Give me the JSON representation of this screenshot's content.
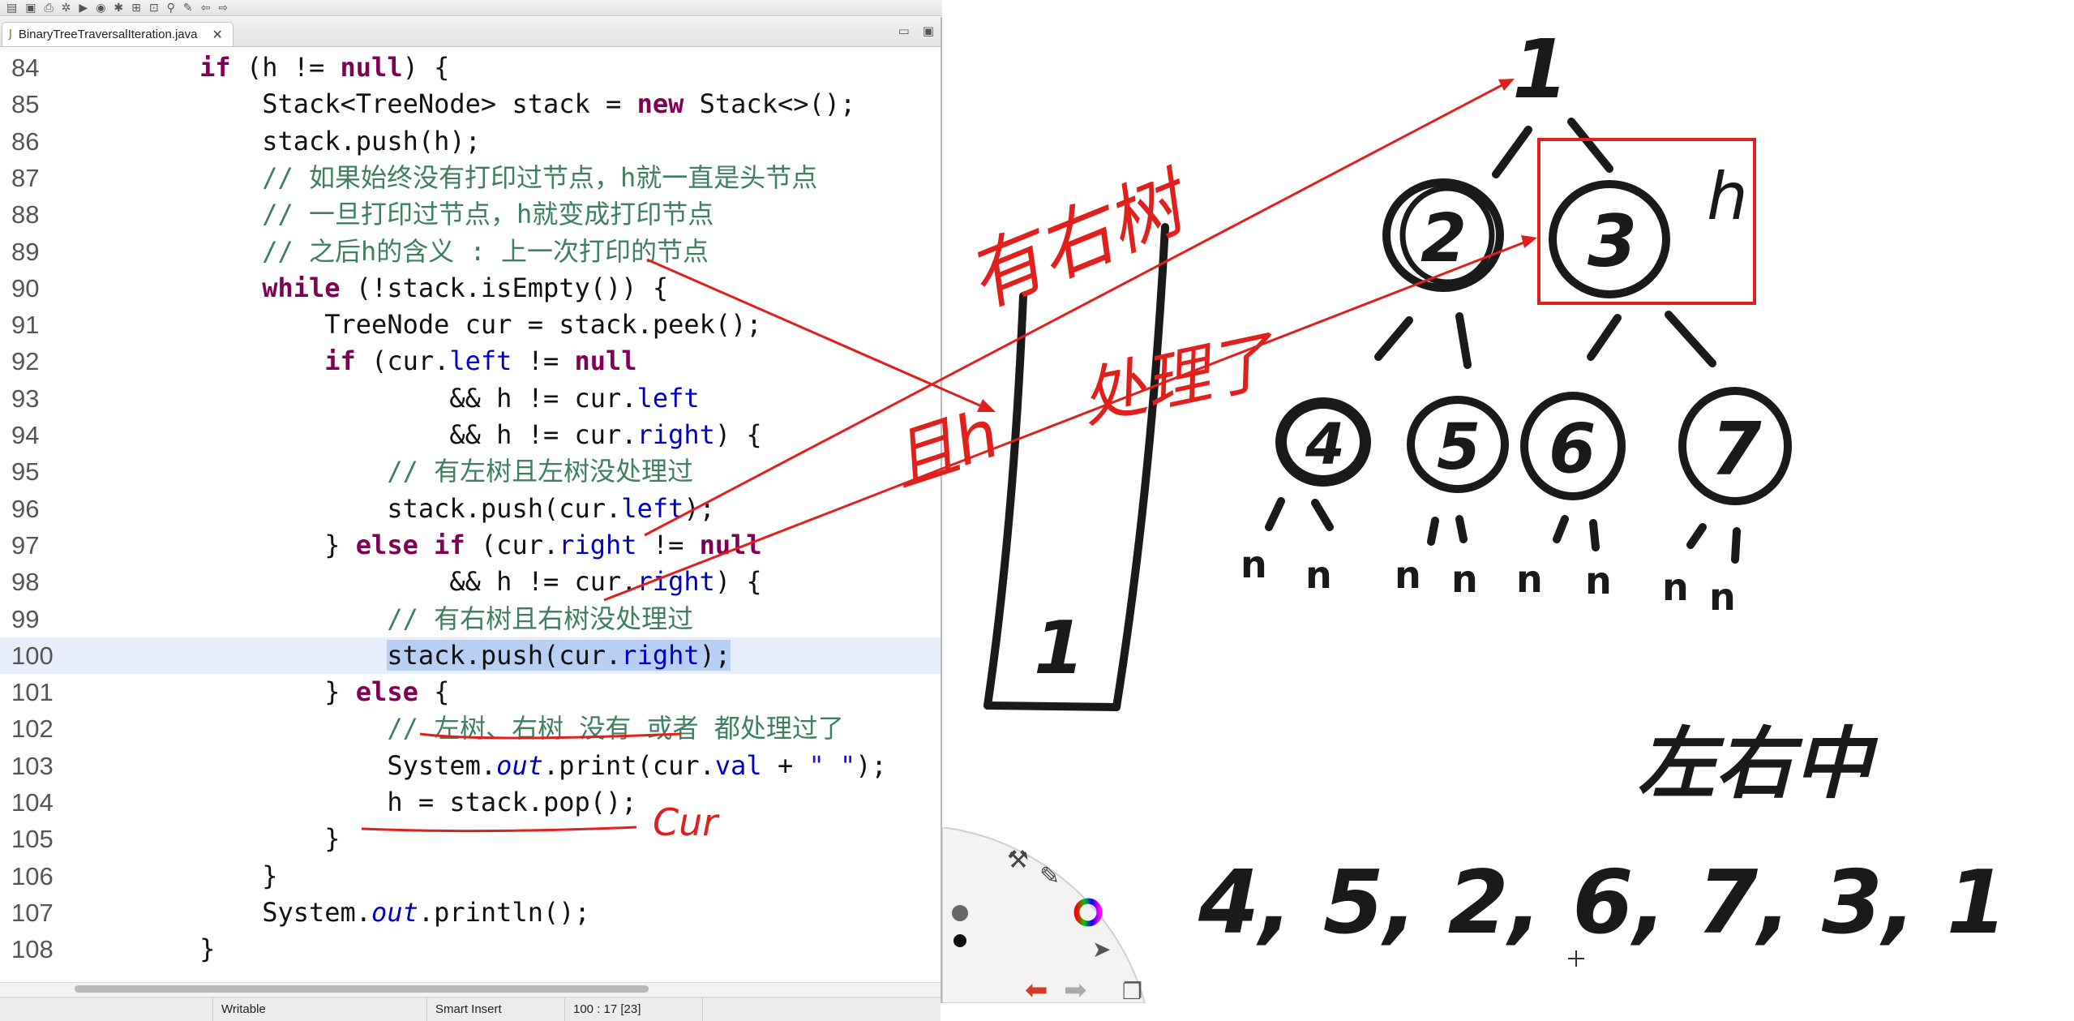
{
  "editor": {
    "tab_title": "BinaryTreeTraversalIteration.java",
    "lines": [
      {
        "n": "84",
        "html": "        <span class='kw'>if</span> (h != <span class='kw'>null</span>) {"
      },
      {
        "n": "85",
        "html": "            Stack&lt;TreeNode&gt; stack = <span class='kw'>new</span> Stack&lt;&gt;();"
      },
      {
        "n": "86",
        "html": "            stack.push(h);"
      },
      {
        "n": "87",
        "html": "            <span class='cm'>// 如果始终没有打印过节点，h就一直是头节点</span>"
      },
      {
        "n": "88",
        "html": "            <span class='cm'>// 一旦打印过节点，h就变成打印节点</span>"
      },
      {
        "n": "89",
        "html": "            <span class='cm'>// 之后h的含义 : 上一次打印的节点</span>"
      },
      {
        "n": "90",
        "html": "            <span class='kw'>while</span> (!stack.isEmpty()) {"
      },
      {
        "n": "91",
        "html": "                TreeNode cur = stack.peek();"
      },
      {
        "n": "92",
        "html": "                <span class='kw'>if</span> (cur.<span class='fd'>left</span> != <span class='kw'>null</span>"
      },
      {
        "n": "93",
        "html": "                        &amp;&amp; h != cur.<span class='fd'>left</span>"
      },
      {
        "n": "94",
        "html": "                        &amp;&amp; h != cur.<span class='fd'>right</span>) {"
      },
      {
        "n": "95",
        "html": "                    <span class='cm'>// 有左树且左树没处理过</span>"
      },
      {
        "n": "96",
        "html": "                    stack.push(cur.<span class='fd'>left</span>);"
      },
      {
        "n": "97",
        "html": "                } <span class='kw'>else if</span> (cur.<span class='fd'>right</span> != <span class='kw'>null</span>"
      },
      {
        "n": "98",
        "html": "                        &amp;&amp; h != cur.<span class='fd'>right</span>) {"
      },
      {
        "n": "99",
        "html": "                    <span class='cm'>// 有右树且右树没处理过</span>"
      },
      {
        "n": "100",
        "html": "                    <span class='sel'>stack.push(cur.<span class='fd'>right</span>);</span>",
        "current": true
      },
      {
        "n": "101",
        "html": "                } <span class='kw'>else</span> {"
      },
      {
        "n": "102",
        "html": "                    <span class='cm'>// 左树、右树 没有 或者 都处理过了</span>"
      },
      {
        "n": "103",
        "html": "                    System.<span class='st'>out</span>.print(cur.<span class='fd'>val</span> + <span class='str'>\" \"</span>);"
      },
      {
        "n": "104",
        "html": "                    h = stack.pop();"
      },
      {
        "n": "105",
        "html": "                }"
      },
      {
        "n": "106",
        "html": "            }"
      },
      {
        "n": "107",
        "html": "            System.<span class='st'>out</span>.println();"
      },
      {
        "n": "108",
        "html": "        }"
      }
    ]
  },
  "status": {
    "writable": "Writable",
    "insert_mode": "Smart Insert",
    "position": "100 : 17 [23]"
  },
  "annotations": {
    "cur_label": "Cur",
    "has_right": "有右树",
    "and_h": "且h",
    "processed": "处理了",
    "h_label": "h",
    "order_label": "左右中",
    "postorder": "4, 5, 2, 6, 7, 3, 1",
    "stack_item": "1"
  },
  "tree": {
    "nodes": [
      "1",
      "2",
      "3",
      "4",
      "5",
      "6",
      "7"
    ],
    "highlight_node": "3",
    "accent_color": "#e0201c",
    "ink_color": "#1a1a1a"
  }
}
